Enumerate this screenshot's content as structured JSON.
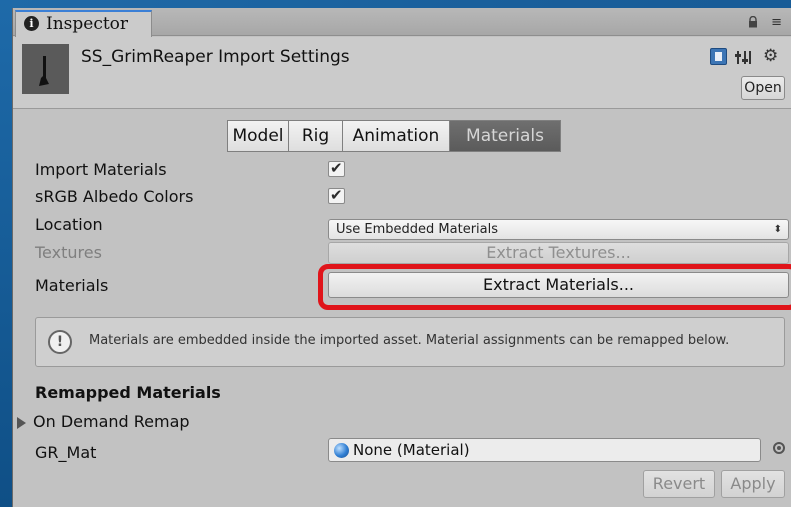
{
  "tab": {
    "label": "Inspector",
    "info_icon": "info-icon"
  },
  "tab_icons": {
    "lock": "lock-icon",
    "menu": "≡"
  },
  "header": {
    "title": "SS_GrimReaper Import Settings",
    "open_label": "Open",
    "icons": [
      "book-icon",
      "preset-icon",
      "gear-icon"
    ]
  },
  "segments": [
    {
      "label": "Model",
      "active": false
    },
    {
      "label": "Rig",
      "active": false
    },
    {
      "label": "Animation",
      "active": false
    },
    {
      "label": "Materials",
      "active": true
    }
  ],
  "form": {
    "import_materials": {
      "label": "Import Materials",
      "checked": true
    },
    "srgb_albedo": {
      "label": "sRGB Albedo Colors",
      "checked": true
    },
    "location": {
      "label": "Location",
      "value": "Use Embedded Materials"
    },
    "textures": {
      "label": "Textures",
      "button": "Extract Textures..."
    },
    "materials": {
      "label": "Materials",
      "button": "Extract Materials..."
    }
  },
  "help": {
    "icon_text": "!",
    "message": "Materials are embedded inside the imported asset. Material assignments can be remapped below."
  },
  "remapped": {
    "heading": "Remapped Materials",
    "foldout": "On Demand Remap",
    "items": [
      {
        "name": "GR_Mat",
        "value": "None (Material)"
      }
    ]
  },
  "footer": {
    "revert": "Revert",
    "apply": "Apply"
  },
  "colors": {
    "highlight": "#e0141a",
    "active_tab": "#5b5b5b"
  }
}
